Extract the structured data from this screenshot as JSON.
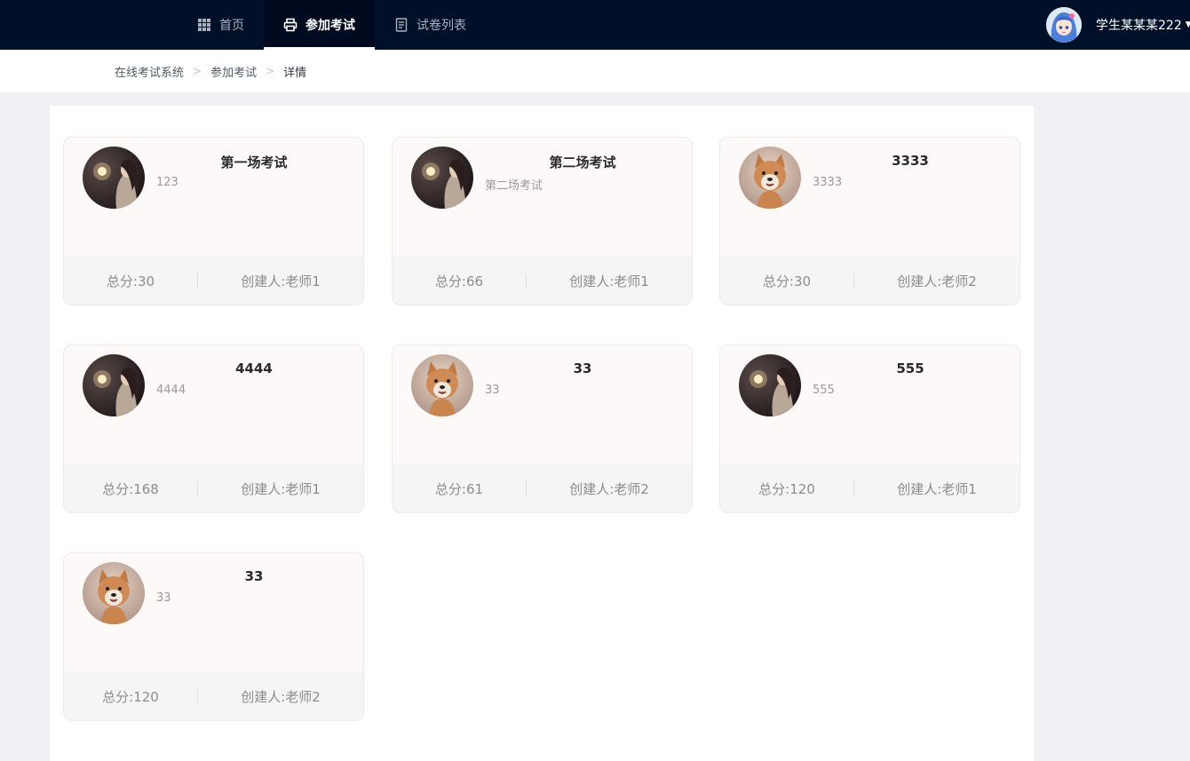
{
  "nav": {
    "items": [
      {
        "label": "首页",
        "icon": "grid-icon",
        "active": false
      },
      {
        "label": "参加考试",
        "icon": "printer-icon",
        "active": true
      },
      {
        "label": "试卷列表",
        "icon": "document-icon",
        "active": false
      }
    ],
    "user": {
      "name": "学生某某某222"
    }
  },
  "breadcrumb": {
    "items": [
      "在线考试系统",
      "参加考试",
      "详情"
    ]
  },
  "exams": [
    {
      "title": "第一场考试",
      "desc": "123",
      "score": "总分:30",
      "creator": "创建人:老师1",
      "avatar": "girl-sparkler"
    },
    {
      "title": "第二场考试",
      "desc": "第二场考试",
      "score": "总分:66",
      "creator": "创建人:老师1",
      "avatar": "girl-sparkler"
    },
    {
      "title": "3333",
      "desc": "3333",
      "score": "总分:30",
      "creator": "创建人:老师2",
      "avatar": "shiba-dog"
    },
    {
      "title": "4444",
      "desc": "4444",
      "score": "总分:168",
      "creator": "创建人:老师1",
      "avatar": "girl-sparkler"
    },
    {
      "title": "33",
      "desc": "33",
      "score": "总分:61",
      "creator": "创建人:老师2",
      "avatar": "shiba-dog"
    },
    {
      "title": "555",
      "desc": "555",
      "score": "总分:120",
      "creator": "创建人:老师1",
      "avatar": "girl-sparkler"
    },
    {
      "title": "33",
      "desc": "33",
      "score": "总分:120",
      "creator": "创建人:老师2",
      "avatar": "shiba-dog"
    }
  ],
  "colors": {
    "topbar": "#001028",
    "card_bg": "#fdf9f8",
    "card_footer": "#f5f5f5",
    "page_bg": "#f0f1f5"
  }
}
